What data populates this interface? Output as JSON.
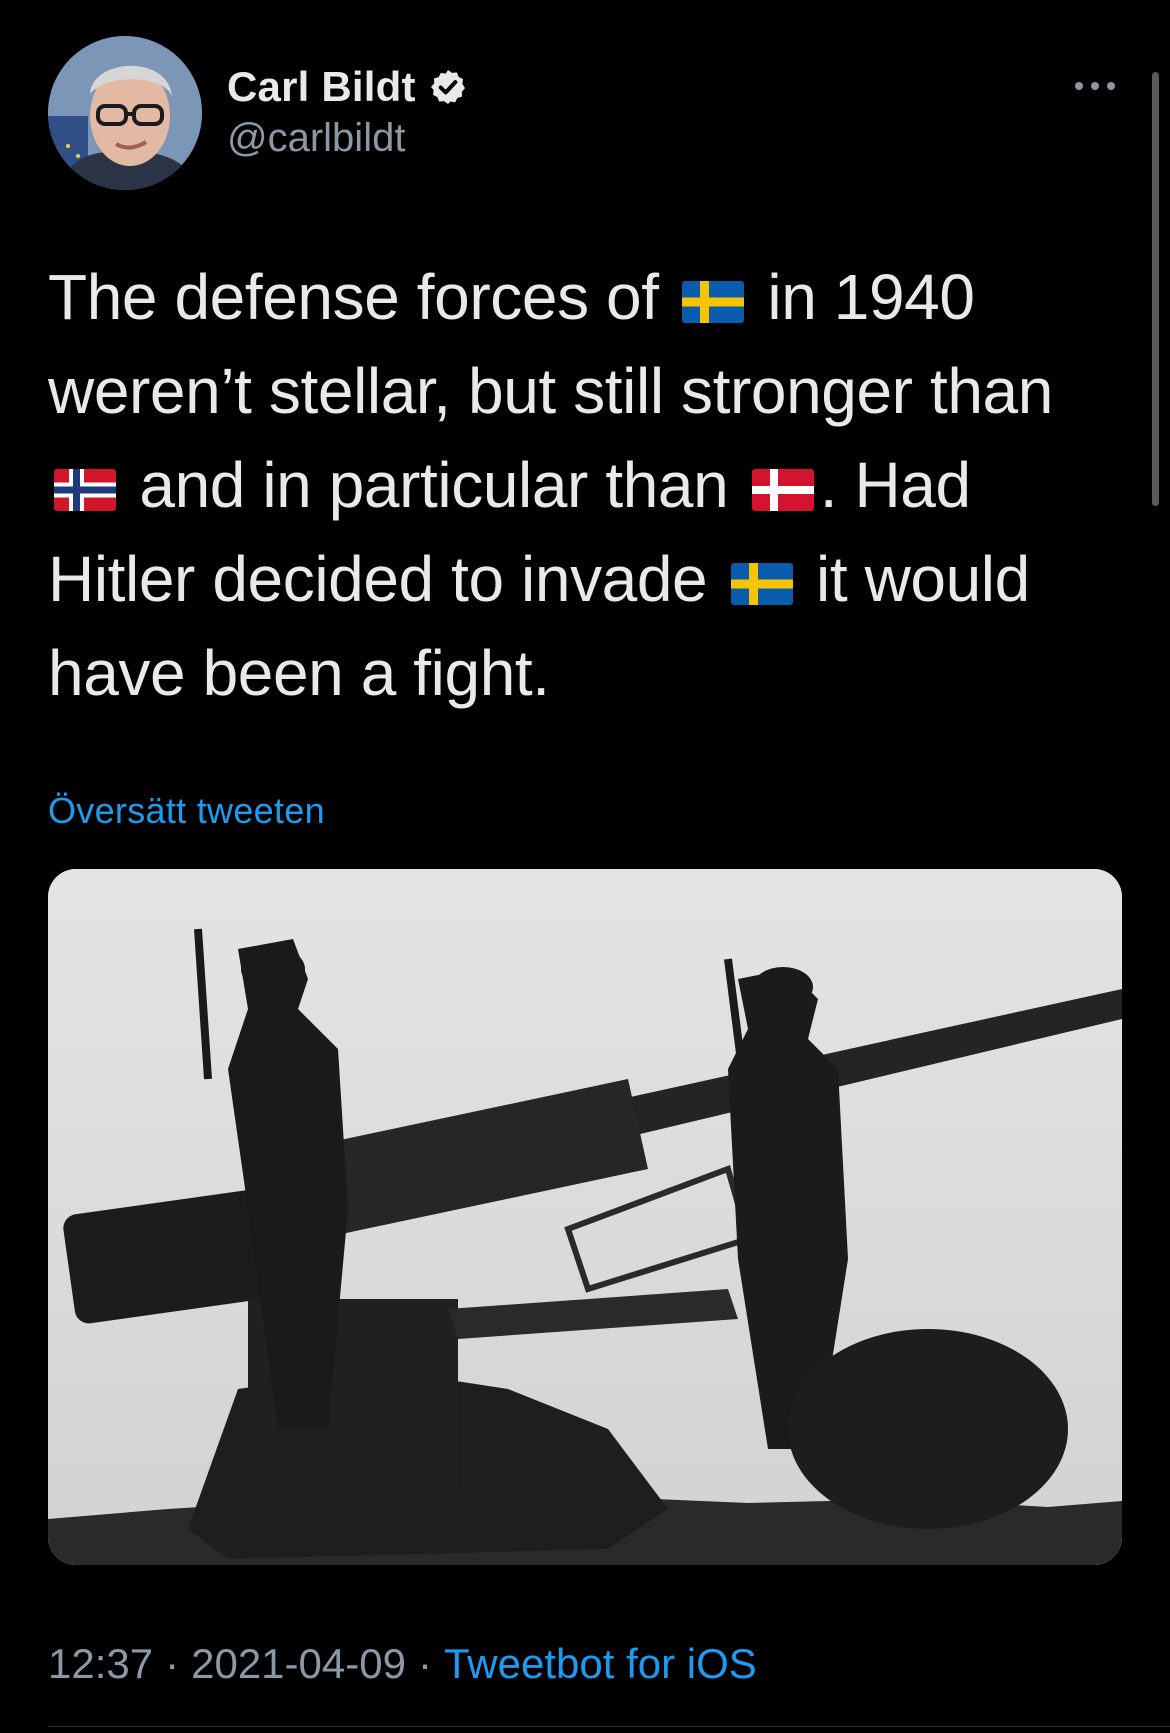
{
  "author": {
    "display_name": "Carl Bildt",
    "handle": "@carlbildt",
    "verified": true
  },
  "tweet": {
    "lines": [
      [
        {
          "text": "The defense forces of "
        },
        {
          "flag": "sweden-flag-icon"
        },
        {
          "text": " in 1940"
        }
      ],
      [
        {
          "text": "weren’t stellar, but still stronger than"
        }
      ],
      [
        {
          "flag": "norway-flag-icon"
        },
        {
          "text": " and in particular than "
        },
        {
          "flag": "denmark-flag-icon"
        },
        {
          "text": ". Had"
        }
      ],
      [
        {
          "text": "Hitler decided to invade "
        },
        {
          "flag": "sweden-flag-icon"
        },
        {
          "text": " it would"
        }
      ],
      [
        {
          "text": "have been a fight."
        }
      ]
    ],
    "translate_label": "Översätt tweeten",
    "media_description": "black-and-white-photo-soldiers-silhouetted-beside-anti-aircraft-gun"
  },
  "meta": {
    "time": "12:37",
    "date": "2021-04-09",
    "separator": "·",
    "source": "Tweetbot for iOS"
  },
  "icons": {
    "more": "more-horizontal-icon",
    "verified": "verified-badge-icon"
  },
  "colors": {
    "background": "#000000",
    "text_primary": "#e7e9ea",
    "text_secondary": "#8b98a5",
    "link": "#1d9bf0",
    "verified_badge": "#e7e9ea"
  }
}
